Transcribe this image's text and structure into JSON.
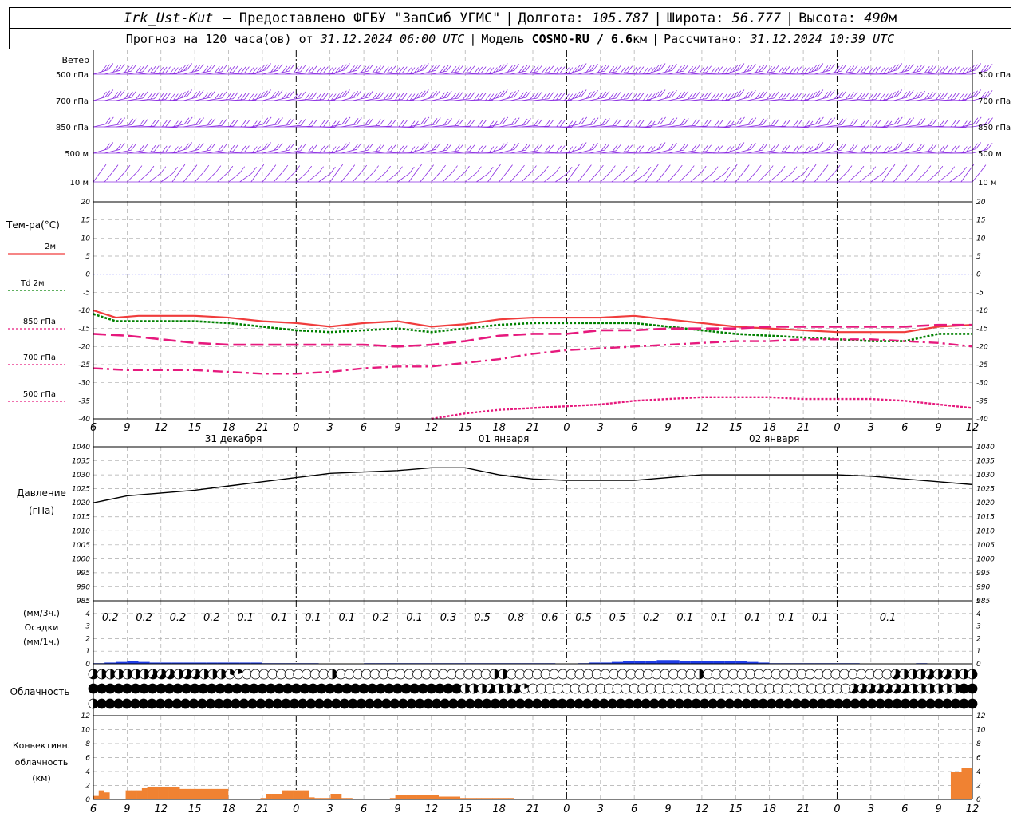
{
  "header": {
    "station": "Irk_Ust-Kut",
    "provided": "– Предоставлено ФГБУ \"ЗапСиб УГМС\"",
    "lon_label": "Долгота:",
    "lon": "105.787",
    "lat_label": "Широта:",
    "lat": "56.777",
    "alt_label": "Высота:",
    "alt": "490",
    "alt_unit": "м",
    "forecast_label": "Прогноз на 120 часа(ов) от",
    "forecast_time": "31.12.2024 06:00 UTC",
    "model_label": "Модель",
    "model": "COSMO-RU / 6.6",
    "model_unit": "км",
    "calc_label": "Рассчитано:",
    "calc_time": "31.12.2024 10:39 UTC"
  },
  "labels": {
    "wind_title": "Ветер",
    "wind_levels": [
      "500 гПа",
      "700 гПа",
      "850 гПа",
      "500 м",
      "10 м"
    ],
    "temp_title": "Тем-ра(°C)",
    "temp_legend": [
      "2м",
      "Td 2м",
      "850 гПа",
      "700 гПа",
      "500 гПа"
    ],
    "pressure_title": "Давление",
    "pressure_unit": "(гПа)",
    "precip_unit3": "(мм/3ч.)",
    "precip_title": "Осадки",
    "precip_unit1": "(мм/1ч.)",
    "cloud_title": "Облачность",
    "conv_title": "Конвективн.",
    "conv_title2": "облачность",
    "conv_unit": "(км)"
  },
  "colors": {
    "t2m": "#f03c3c",
    "td2m": "#008000",
    "t850": "#e6197d",
    "t700": "#e6197d",
    "t500": "#e6197d",
    "zero": "#3232ff",
    "wind": "#8a2be2",
    "pressure": "#000000",
    "precip": "#1e3ce6",
    "conv": "#f08232"
  },
  "chart_data": {
    "type": "line",
    "time_axis": {
      "tick_labels": [
        "6",
        "9",
        "12",
        "15",
        "18",
        "21",
        "0",
        "3",
        "6",
        "9",
        "12",
        "15",
        "18",
        "21",
        "0",
        "3",
        "6",
        "9",
        "12",
        "15",
        "18",
        "21",
        "0",
        "3",
        "6",
        "9",
        "12"
      ],
      "day_labels": [
        {
          "label": "31 декабря",
          "hour": 12
        },
        {
          "label": "01 января",
          "hour": 36
        },
        {
          "label": "02 января",
          "hour": 60
        }
      ],
      "hours_range": [
        0,
        78
      ]
    },
    "wind": {
      "levels": [
        "500 гПа",
        "700 гПа",
        "850 гПа",
        "500 м",
        "10 м"
      ],
      "directions": [
        250,
        250,
        255,
        250,
        210
      ],
      "speed_class": [
        3,
        3,
        2,
        2,
        1
      ]
    },
    "temperature": {
      "ylim": [
        -40,
        20
      ],
      "yticks": [
        -40,
        -35,
        -30,
        -25,
        -20,
        -15,
        -10,
        -5,
        0,
        5,
        10,
        15,
        20
      ],
      "series": [
        {
          "name": "2м",
          "x": [
            0,
            2,
            4,
            6,
            9,
            12,
            15,
            18,
            21,
            24,
            27,
            30,
            33,
            36,
            39,
            42,
            45,
            48,
            51,
            54,
            57,
            60,
            63,
            66,
            69,
            72,
            75,
            78
          ],
          "y": [
            -10,
            -12,
            -11.5,
            -11.5,
            -11.5,
            -12,
            -13,
            -13.5,
            -14.5,
            -13.5,
            -13,
            -14.5,
            -13.8,
            -12.5,
            -12,
            -12,
            -12,
            -11.5,
            -12.5,
            -13.5,
            -14.5,
            -15,
            -15.5,
            -16,
            -16,
            -16,
            -14.5,
            -14
          ]
        },
        {
          "name": "Td 2м",
          "x": [
            0,
            2,
            4,
            6,
            9,
            12,
            15,
            18,
            21,
            24,
            27,
            30,
            33,
            36,
            39,
            42,
            45,
            48,
            51,
            54,
            57,
            60,
            63,
            66,
            69,
            72,
            75,
            78
          ],
          "y": [
            -11,
            -13,
            -13,
            -13,
            -13,
            -13.5,
            -14.5,
            -15.5,
            -16,
            -15.5,
            -15,
            -16,
            -15,
            -14,
            -13.5,
            -13.5,
            -13.5,
            -13.5,
            -14.5,
            -15.5,
            -16.5,
            -17,
            -17.5,
            -18,
            -18.5,
            -18.5,
            -16.5,
            -16.5
          ]
        },
        {
          "name": "850 гПа",
          "x": [
            0,
            3,
            6,
            9,
            12,
            15,
            18,
            21,
            24,
            27,
            30,
            33,
            36,
            39,
            42,
            45,
            48,
            51,
            54,
            57,
            60,
            63,
            66,
            69,
            72,
            75,
            78
          ],
          "y": [
            -16.5,
            -17,
            -18,
            -19,
            -19.5,
            -19.5,
            -19.5,
            -19.5,
            -19.5,
            -20,
            -19.5,
            -18.5,
            -17,
            -16.5,
            -16.5,
            -15.5,
            -15.5,
            -15,
            -15,
            -15,
            -14.5,
            -14.5,
            -14.5,
            -14.5,
            -14.5,
            -14,
            -14
          ]
        },
        {
          "name": "700 гПа",
          "x": [
            0,
            3,
            6,
            9,
            12,
            15,
            18,
            21,
            24,
            27,
            30,
            33,
            36,
            39,
            42,
            45,
            48,
            51,
            54,
            57,
            60,
            63,
            66,
            69,
            72,
            75,
            78
          ],
          "y": [
            -26,
            -26.5,
            -26.5,
            -26.5,
            -27,
            -27.5,
            -27.5,
            -27,
            -26,
            -25.5,
            -25.5,
            -24.5,
            -23.5,
            -22,
            -21,
            -20.5,
            -20,
            -19.5,
            -19,
            -18.5,
            -18.5,
            -18,
            -18,
            -18,
            -18.5,
            -19,
            -20
          ]
        },
        {
          "name": "500 гПа",
          "x": [
            30,
            33,
            36,
            39,
            42,
            45,
            48,
            51,
            54,
            57,
            60,
            63,
            66,
            69,
            72,
            75,
            78
          ],
          "y": [
            -40,
            -38.5,
            -37.5,
            -37,
            -36.5,
            -36,
            -35,
            -34.5,
            -34,
            -34,
            -34,
            -34.5,
            -34.5,
            -34.5,
            -35,
            -36,
            -37
          ]
        }
      ]
    },
    "pressure": {
      "ylim": [
        985,
        1040
      ],
      "yticks": [
        985,
        990,
        995,
        1000,
        1005,
        1010,
        1015,
        1020,
        1025,
        1030,
        1035,
        1040
      ],
      "x": [
        0,
        3,
        6,
        9,
        12,
        15,
        18,
        21,
        24,
        27,
        30,
        33,
        36,
        39,
        42,
        45,
        48,
        51,
        54,
        57,
        60,
        63,
        66,
        69,
        72,
        75,
        78
      ],
      "y": [
        1020,
        1022.5,
        1023.5,
        1024.5,
        1026,
        1027.5,
        1029,
        1030.5,
        1031,
        1031.5,
        1032.5,
        1032.5,
        1030,
        1028.5,
        1028,
        1028,
        1028,
        1029,
        1030,
        1030,
        1030,
        1030,
        1030,
        1029.5,
        1028.5,
        1027.5,
        1026.5
      ]
    },
    "precipitation": {
      "ylim": [
        0,
        5
      ],
      "yticks": [
        0,
        1,
        2,
        3,
        4,
        5
      ],
      "totals_3h": [
        "0.2",
        "0.2",
        "0.2",
        "0.2",
        "0.1",
        "0.1",
        "0.1",
        "0.1",
        "0.2",
        "0.1",
        "0.3",
        "0.5",
        "0.8",
        "0.6",
        "0.5",
        "0.5",
        "0.2",
        "0.1",
        "0.1",
        "0.1",
        "0.1",
        "0.1",
        "",
        "0.1"
      ],
      "hourly": [
        0.05,
        0.1,
        0.15,
        0.2,
        0.15,
        0.1,
        0.1,
        0.1,
        0.1,
        0.1,
        0.1,
        0.1,
        0.1,
        0.1,
        0.1,
        0.05,
        0.05,
        0.05,
        0.05,
        0.05,
        0,
        0,
        0,
        0,
        0.05,
        0.05,
        0.05,
        0.05,
        0.05,
        0.05,
        0.05,
        0.05,
        0.05,
        0.05,
        0.05,
        0.05,
        0.05,
        0.05,
        0.05,
        0.05,
        0.05,
        0,
        0,
        0.05,
        0.1,
        0.1,
        0.15,
        0.2,
        0.25,
        0.25,
        0.3,
        0.3,
        0.25,
        0.25,
        0.25,
        0.25,
        0.2,
        0.2,
        0.15,
        0.1,
        0.05,
        0.05,
        0.05,
        0.05,
        0.05,
        0.05,
        0.05,
        0.05,
        0,
        0,
        0,
        0,
        0,
        0.05,
        0,
        0,
        0,
        0
      ]
    },
    "cloudiness": {
      "rows": 3,
      "cover": [
        [
          0.6,
          0.5,
          0.5,
          0.5,
          0.5,
          0.5,
          0.5,
          0.6,
          0.6,
          0.6,
          0.5,
          0.6,
          0.6,
          0.5,
          0.5,
          0.5,
          0.3,
          0.2,
          0,
          0,
          0,
          0,
          0,
          0,
          0,
          0,
          0,
          0,
          0.5,
          0,
          0,
          0,
          0,
          0,
          0,
          0,
          0,
          0,
          0,
          0,
          0,
          0,
          0,
          0,
          0,
          0,
          0,
          0.5,
          0.5,
          0,
          0,
          0,
          0,
          0,
          0,
          0,
          0,
          0,
          0,
          0,
          0,
          0,
          0,
          0,
          0,
          0,
          0,
          0,
          0,
          0,
          0,
          0.5,
          0,
          0,
          0,
          0,
          0,
          0,
          0,
          0,
          0,
          0,
          0,
          0,
          0,
          0,
          0,
          0,
          0,
          0,
          0,
          0,
          0,
          0,
          0.6,
          0.5,
          0.5,
          0.5,
          0.6,
          0.5,
          0.6,
          0.5,
          0.5,
          0.5
        ],
        [
          1,
          1,
          1,
          1,
          1,
          1,
          1,
          1,
          1,
          1,
          1,
          1,
          1,
          1,
          1,
          1,
          1,
          1,
          1,
          1,
          1,
          1,
          1,
          1,
          1,
          1,
          1,
          1,
          1,
          1,
          1,
          1,
          1,
          1,
          1,
          1,
          1,
          1,
          1,
          1,
          1,
          1,
          1,
          1,
          0.5,
          0.5,
          0.5,
          0.6,
          0.5,
          0.5,
          0.6,
          0.2,
          0,
          0,
          0,
          0,
          0,
          0,
          0,
          0,
          0,
          0,
          0,
          0,
          0,
          0,
          0,
          0,
          0,
          0,
          0,
          0,
          0,
          0,
          0,
          0,
          0,
          0,
          0,
          0,
          0,
          0,
          0,
          0,
          0,
          0,
          0,
          0,
          0,
          0,
          0.6,
          0.6,
          0.6,
          0.6,
          0.6,
          0.6,
          0.6,
          0.5,
          0.5,
          0.5,
          0.5,
          0.5,
          0.5,
          1,
          1
        ],
        [
          0.5,
          1,
          1,
          1,
          1,
          1,
          1,
          1,
          1,
          1,
          1,
          1,
          1,
          1,
          1,
          1,
          1,
          1,
          1,
          1,
          1,
          1,
          1,
          1,
          1,
          1,
          1,
          1,
          1,
          1,
          1,
          1,
          1,
          1,
          1,
          1,
          1,
          1,
          1,
          1,
          1,
          1,
          1,
          1,
          1,
          1,
          1,
          1,
          1,
          1,
          1,
          1,
          1,
          1,
          1,
          1,
          1,
          1,
          1,
          1,
          1,
          1,
          1,
          1,
          1,
          1,
          1,
          1,
          1,
          1,
          1,
          1,
          1,
          1,
          1,
          1,
          1,
          1,
          1,
          1,
          1,
          1,
          1,
          1,
          1,
          1,
          1,
          1,
          1,
          1,
          1,
          1,
          1,
          1,
          1,
          1,
          1,
          1,
          1,
          1,
          1,
          1,
          1,
          1,
          1,
          1
        ]
      ]
    },
    "convective": {
      "ylim": [
        0,
        12
      ],
      "yticks": [
        0,
        2,
        4,
        6,
        8,
        10,
        12
      ],
      "hourly": [
        0.5,
        1.3,
        1,
        0,
        0,
        0,
        1.3,
        1.3,
        1.3,
        1.6,
        1.8,
        1.8,
        1.8,
        1.8,
        1.8,
        1.8,
        1.5,
        1.5,
        1.5,
        1.5,
        1.5,
        1.5,
        1.5,
        1.5,
        1.5,
        0.1,
        0.1,
        0,
        0,
        0,
        0,
        0.2,
        0.8,
        0.8,
        0.8,
        1.3,
        1.3,
        1.3,
        1.3,
        1.3,
        0.3,
        0.2,
        0.2,
        0.2,
        0.8,
        0.8,
        0.2,
        0.2,
        0.1,
        0.1,
        0.1,
        0,
        0,
        0,
        0,
        0.2,
        0.6,
        0.6,
        0.6,
        0.6,
        0.6,
        0.6,
        0.6,
        0.6,
        0.4,
        0.4,
        0.4,
        0.4,
        0.2,
        0.2,
        0.2,
        0.2,
        0.2,
        0.2,
        0.2,
        0.2,
        0.2,
        0.2,
        0,
        0,
        0,
        0,
        0,
        0,
        0,
        0,
        0,
        0,
        0,
        0,
        0,
        0.1,
        0.1,
        0.1,
        0.1,
        0.1,
        0.1,
        0.1,
        0.1,
        0.1,
        0.1,
        0.1,
        0.1,
        0.1,
        0.1,
        0.1,
        0.1,
        0.1,
        0.1,
        0.1,
        0.1,
        0.1,
        0.1,
        0.1,
        0.1,
        0.1,
        0.1,
        0.1,
        0.1,
        0.1,
        0.1,
        0.1,
        0.1,
        0.1,
        0.1,
        0.1,
        0.1,
        0.1,
        0.1,
        0.1,
        0.1,
        0.1,
        0.1,
        0.1,
        0.1,
        0.1,
        0.1,
        0.1,
        0.1,
        0.1,
        0.1,
        0.1,
        0.1,
        0.1,
        0.1,
        0.1,
        0.1,
        0.1,
        0.1,
        0.1,
        0.1,
        0.1,
        0.1,
        0.1,
        0.1,
        0.1,
        0.1,
        0.1,
        0.1,
        4,
        4,
        4.5,
        4.5
      ]
    }
  }
}
